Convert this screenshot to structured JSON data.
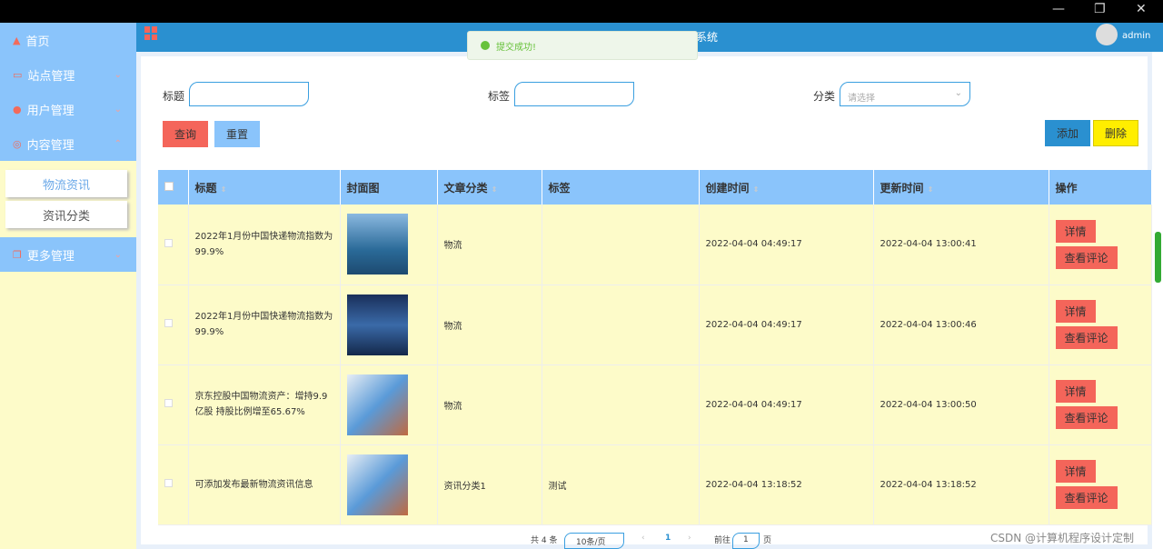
{
  "window": {
    "minimize": "—",
    "restore": "❐",
    "close": "✕"
  },
  "sidebar": {
    "items": [
      {
        "label": "首页",
        "icon": "home-icon"
      },
      {
        "label": "站点管理",
        "icon": "site-icon"
      },
      {
        "label": "用户管理",
        "icon": "user-icon"
      },
      {
        "label": "内容管理",
        "icon": "content-icon"
      }
    ],
    "sub_items": [
      "物流资讯",
      "资讯分类"
    ],
    "more": "更多管理"
  },
  "header": {
    "title_partial": "系统",
    "user": "admin"
  },
  "toast": "提交成功!",
  "search": {
    "title_label": "标题",
    "tag_label": "标签",
    "category_label": "分类",
    "category_placeholder": "请选择",
    "query": "查询",
    "reset": "重置",
    "add": "添加",
    "delete": "删除"
  },
  "table": {
    "headers": [
      "标题",
      "封面图",
      "文章分类",
      "标签",
      "创建时间",
      "更新时间",
      "操作"
    ],
    "rows": [
      {
        "title": "2022年1月份中国快递物流指数为99.9%",
        "category": "物流",
        "tag": "",
        "created": "2022-04-04 04:49:17",
        "updated": "2022-04-04 13:00:41"
      },
      {
        "title": "2022年1月份中国快递物流指数为99.9%",
        "category": "物流",
        "tag": "",
        "created": "2022-04-04 04:49:17",
        "updated": "2022-04-04 13:00:46"
      },
      {
        "title": "京东控股中国物流资产：增持9.9亿股 持股比例增至65.67%",
        "category": "物流",
        "tag": "",
        "created": "2022-04-04 04:49:17",
        "updated": "2022-04-04 13:00:50"
      },
      {
        "title": "可添加发布最新物流资讯信息",
        "category": "资讯分类1",
        "tag": "测试",
        "created": "2022-04-04 13:18:52",
        "updated": "2022-04-04 13:18:52"
      }
    ],
    "detail": "详情",
    "comments": "查看评论"
  },
  "pager": {
    "total": "共 4 条",
    "size": "10条/页",
    "prev": "‹",
    "page": "1",
    "next": "›",
    "goto": "前往",
    "goto_value": "1",
    "page_suffix": "页"
  },
  "watermark": "CSDN @计算机程序设计定制"
}
